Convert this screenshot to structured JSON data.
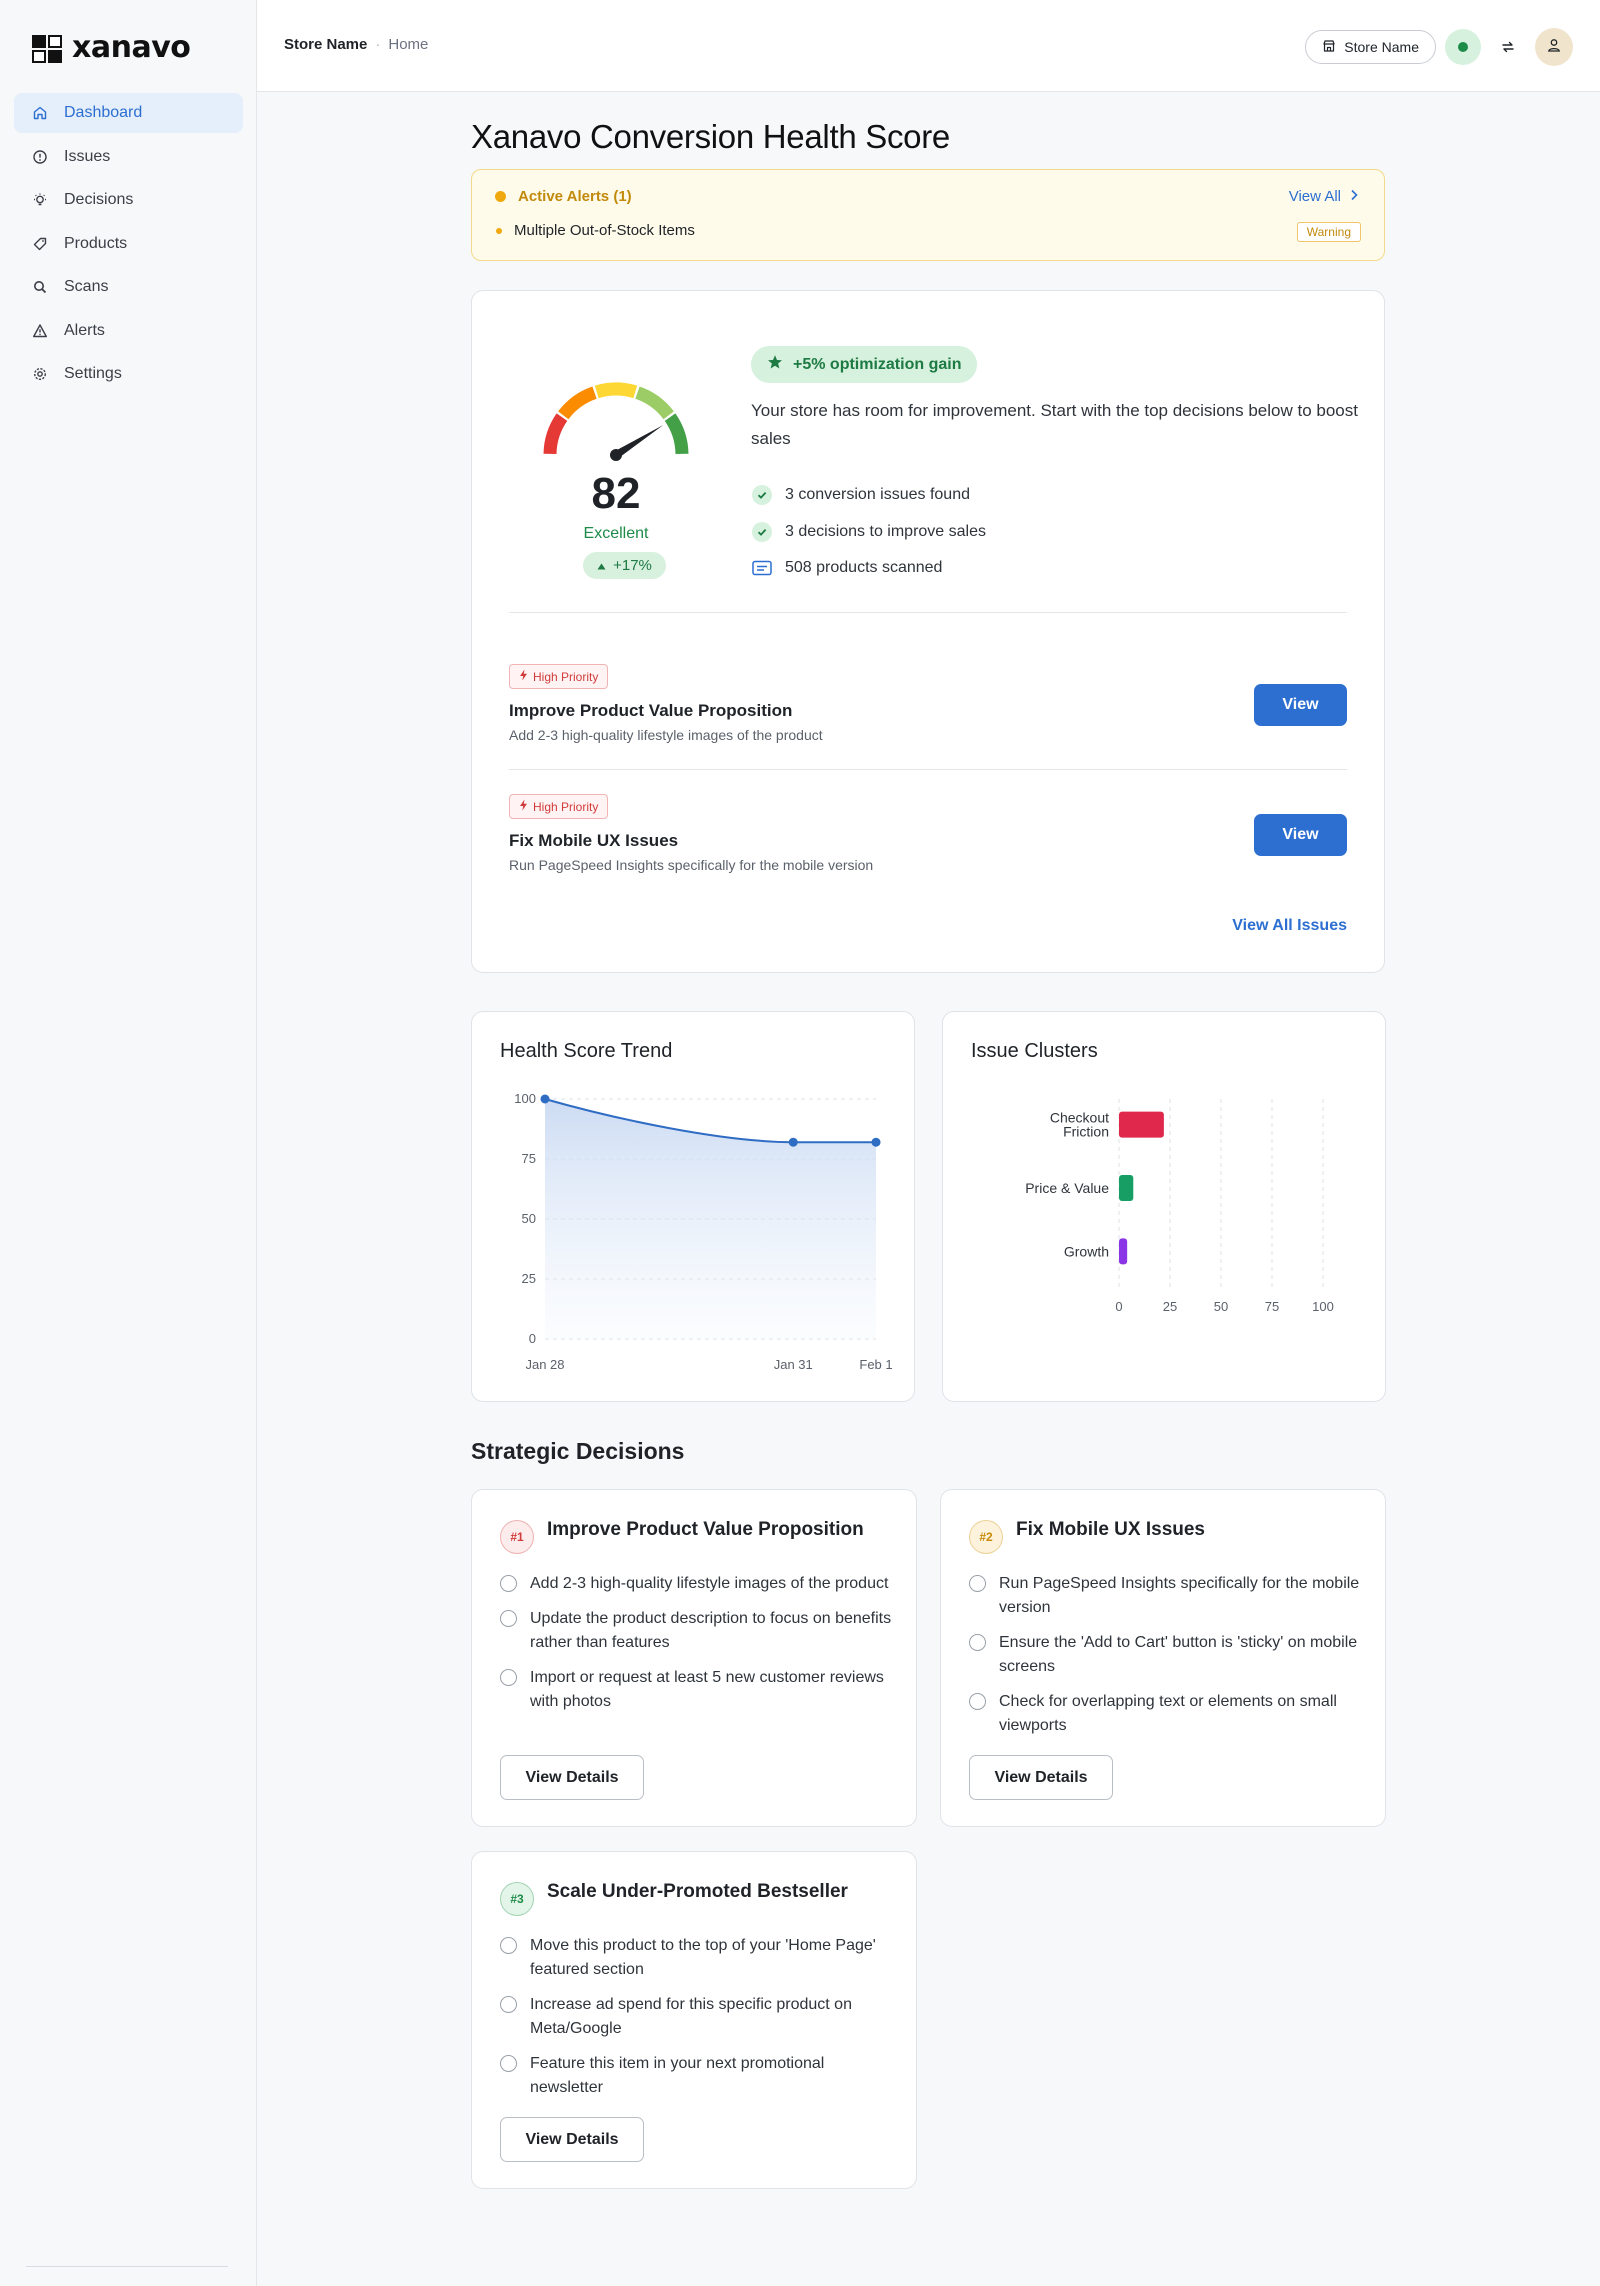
{
  "brand": {
    "name": "xanavo"
  },
  "sidebar": {
    "items": [
      {
        "label": "Dashboard",
        "icon": "home-icon",
        "active": true
      },
      {
        "label": "Issues",
        "icon": "alert-circle-icon"
      },
      {
        "label": "Decisions",
        "icon": "lightbulb-icon"
      },
      {
        "label": "Products",
        "icon": "tag-icon"
      },
      {
        "label": "Scans",
        "icon": "search-icon"
      },
      {
        "label": "Alerts",
        "icon": "warning-triangle-icon"
      },
      {
        "label": "Settings",
        "icon": "gear-icon"
      }
    ]
  },
  "header": {
    "breadcrumb_store": "Store Name",
    "breadcrumb_separator": "·",
    "breadcrumb_page": "Home",
    "store_selector": "Store Name",
    "status_color": "#1d8c48"
  },
  "page": {
    "title": "Xanavo Conversion Health Score"
  },
  "alerts": {
    "heading": "Active Alerts (1)",
    "view_all": "View All",
    "items": [
      {
        "text": "Multiple Out-of-Stock Items",
        "badge": "Warning"
      }
    ]
  },
  "score": {
    "value": "82",
    "rating": "Excellent",
    "delta": "+17%",
    "gauge_value": 82,
    "gain": "+5% optimization gain",
    "description": "Your store has room for improvement. Start with the top decisions below to boost sales",
    "stats": [
      {
        "text": "3 conversion issues found",
        "icon": "check-circle-icon"
      },
      {
        "text": "3 decisions to improve sales",
        "icon": "check-circle-icon"
      },
      {
        "text": "508 products scanned",
        "icon": "list-box-icon"
      }
    ]
  },
  "priorities": [
    {
      "badge": "High Priority",
      "title": "Improve Product Value Proposition",
      "subtitle": "Add 2-3 high-quality lifestyle images of the product",
      "button": "View"
    },
    {
      "badge": "High Priority",
      "title": "Fix Mobile UX Issues",
      "subtitle": "Run PageSpeed Insights specifically for the mobile version",
      "button": "View"
    }
  ],
  "view_all_issues": "View All Issues",
  "charts": {
    "trend_title": "Health Score Trend",
    "clusters_title": "Issue Clusters"
  },
  "chart_data": [
    {
      "type": "area",
      "title": "Health Score Trend",
      "x": [
        "Jan 28",
        "Jan 31",
        "Feb 1"
      ],
      "values": [
        100,
        82,
        82
      ],
      "ylim": [
        0,
        100
      ],
      "yticks": [
        0,
        25,
        50,
        75,
        100
      ],
      "color": "#2f6cc4",
      "grid": true
    },
    {
      "type": "bar",
      "orientation": "horizontal",
      "title": "Issue Clusters",
      "categories": [
        "Checkout Friction",
        "Price & Value",
        "Growth"
      ],
      "values": [
        22,
        7,
        4
      ],
      "colors": [
        "#e0284d",
        "#169e64",
        "#8b36e6"
      ],
      "xlim": [
        0,
        100
      ],
      "xticks": [
        0,
        25,
        50,
        75,
        100
      ],
      "grid": true
    }
  ],
  "decisions": {
    "section_title": "Strategic Decisions",
    "button": "View Details",
    "items": [
      {
        "rank": "#1",
        "title": "Improve Product Value Proposition",
        "rank_color": "#d23b3b",
        "rank_bg": "#fdecec",
        "steps": [
          "Add 2-3 high-quality lifestyle images of the product",
          "Update the product description to focus on benefits rather than features",
          "Import or request at least 5 new customer reviews with photos"
        ]
      },
      {
        "rank": "#2",
        "title": "Fix Mobile UX Issues",
        "rank_color": "#c98a0a",
        "rank_bg": "#fdf3dc",
        "steps": [
          "Run PageSpeed Insights specifically for the mobile version",
          "Ensure the 'Add to Cart' button is 'sticky' on mobile screens",
          "Check for overlapping text or elements on small viewports"
        ]
      },
      {
        "rank": "#3",
        "title": "Scale Under-Promoted Bestseller",
        "rank_color": "#1d8c48",
        "rank_bg": "#e3f5e8",
        "steps": [
          "Move this product to the top of your 'Home Page' featured section",
          "Increase ad spend for this specific product on Meta/Google",
          "Feature this item in your next promotional newsletter"
        ]
      }
    ]
  }
}
